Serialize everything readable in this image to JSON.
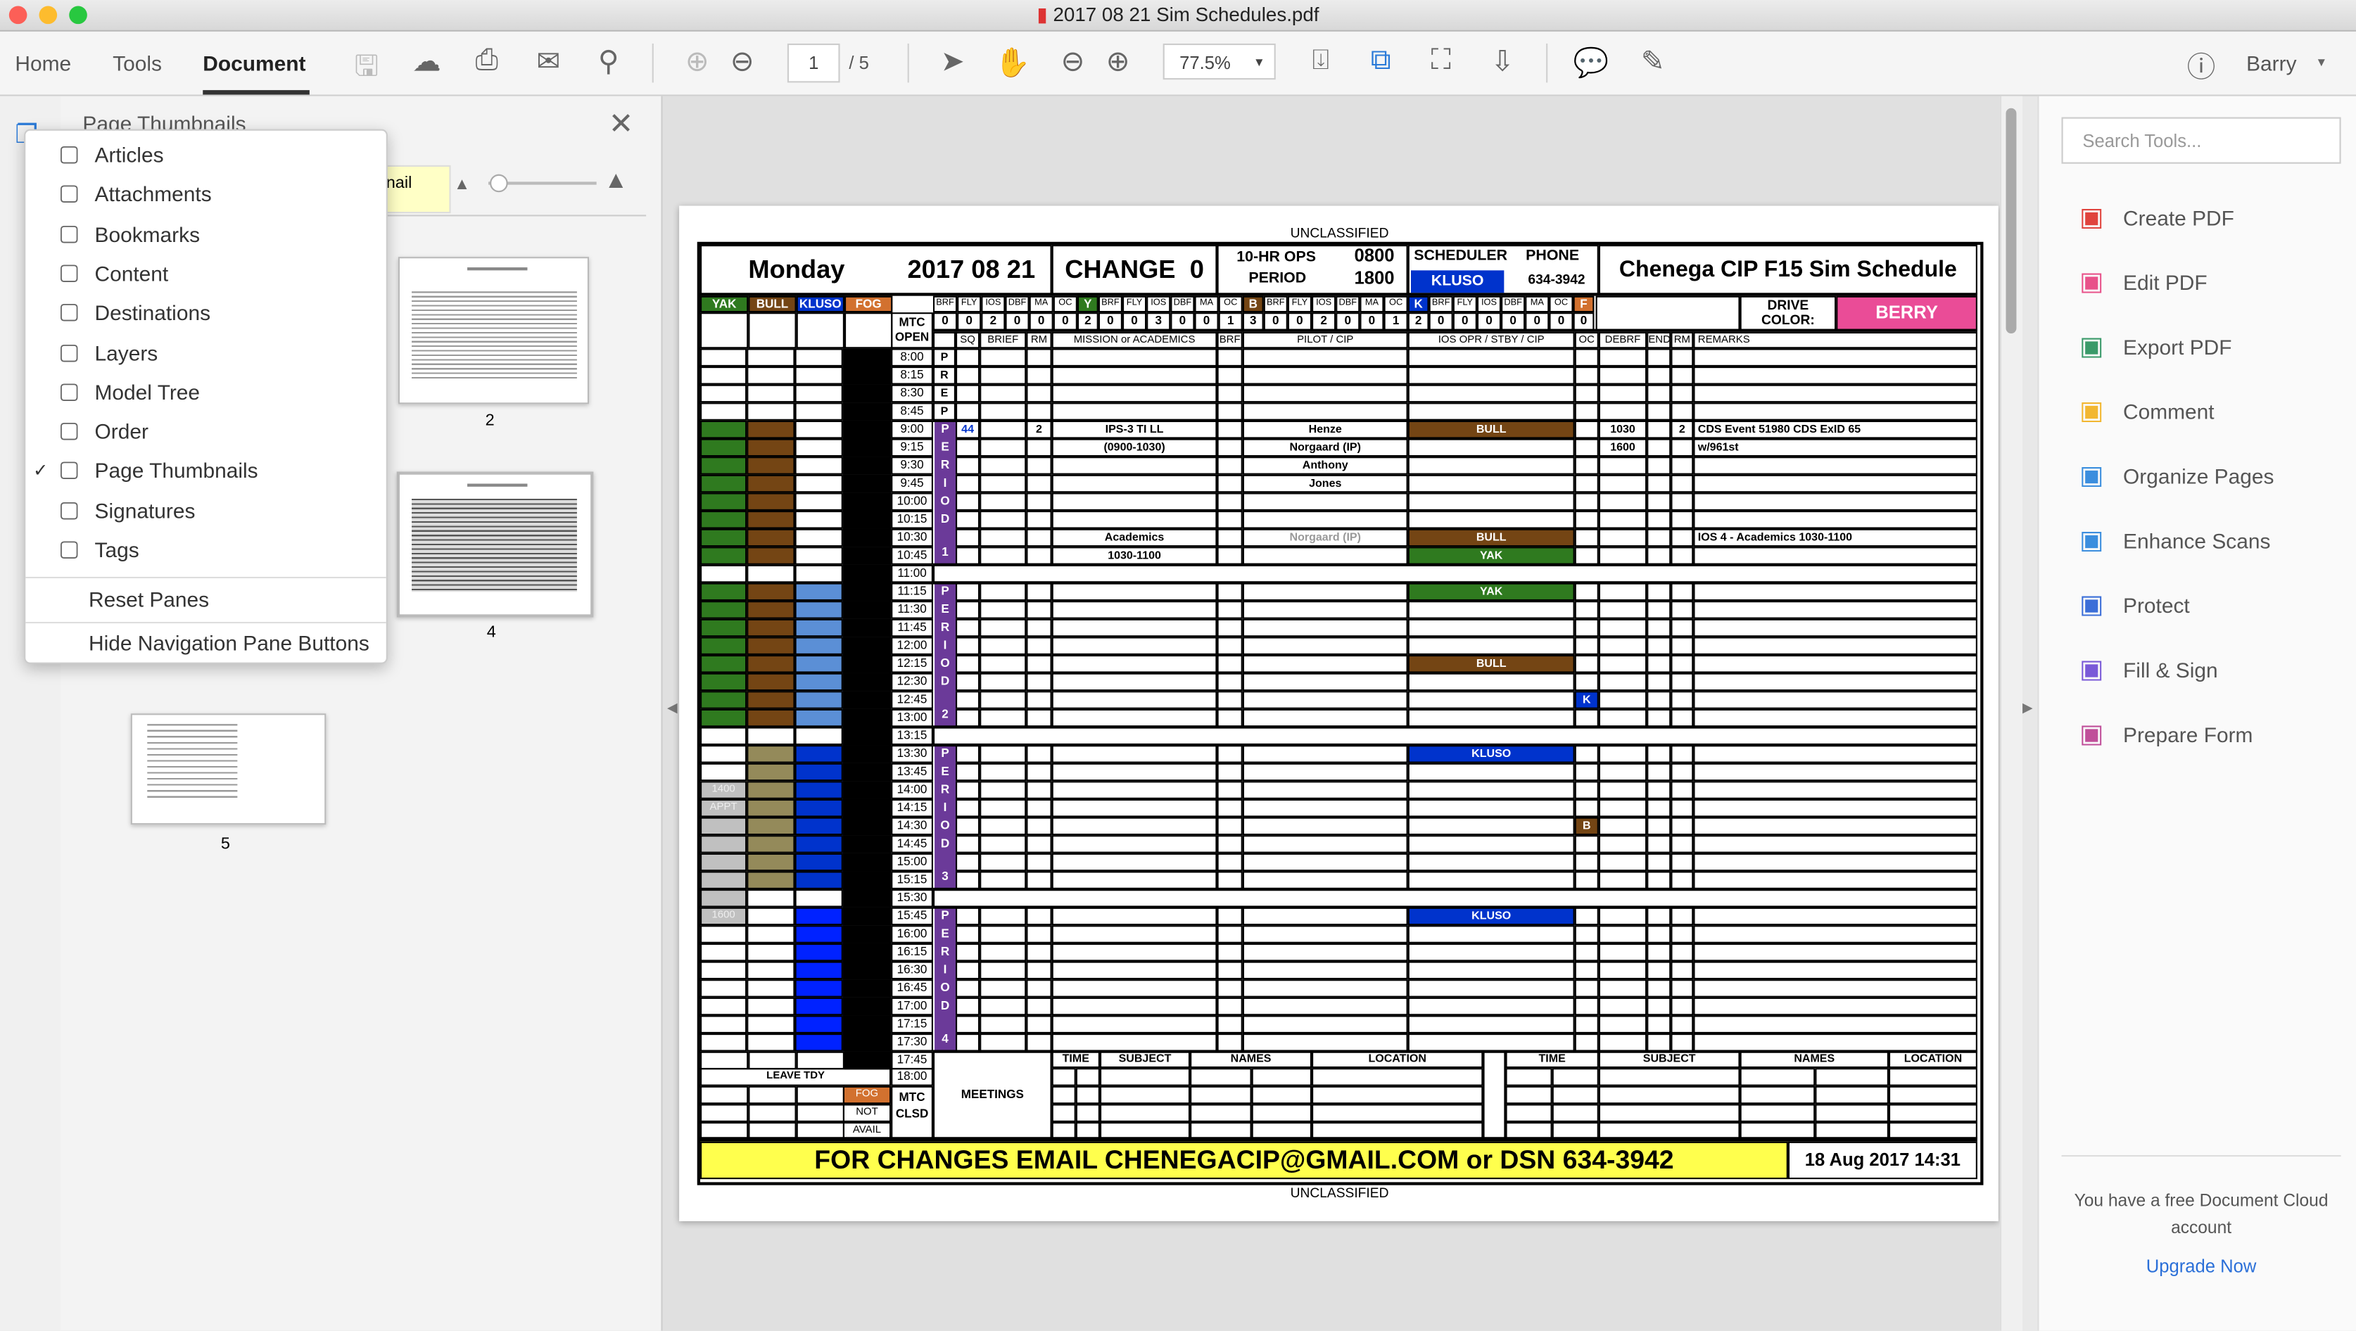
{
  "window": {
    "title": "2017 08 21 Sim Schedules.pdf"
  },
  "toolbar": {
    "tabs": [
      "Home",
      "Tools",
      "Document"
    ],
    "active_tab": "Document",
    "page_current": "1",
    "page_total": "/ 5",
    "zoom": "77.5%",
    "user": "Barry",
    "icons": [
      "save-icon",
      "upload-icon",
      "print-icon",
      "email-icon",
      "search-icon",
      "page-up-icon",
      "page-down-icon",
      "select-arrow-icon",
      "hand-icon",
      "zoom-out-icon",
      "zoom-in-icon",
      "fit-page-icon",
      "fit-width-icon",
      "full-screen-icon",
      "scroll-mode-icon",
      "comment-icon",
      "pen-icon",
      "help-icon"
    ]
  },
  "left_panel": {
    "title": "Page Thumbnails",
    "tooltip_fragment": "nail",
    "thumbnails": [
      "2",
      "4",
      "5"
    ],
    "menu": {
      "items": [
        {
          "label": "Articles",
          "icon": "articles-icon"
        },
        {
          "label": "Attachments",
          "icon": "paperclip-icon"
        },
        {
          "label": "Bookmarks",
          "icon": "bookmark-icon"
        },
        {
          "label": "Content",
          "icon": "content-icon"
        },
        {
          "label": "Destinations",
          "icon": "destinations-icon"
        },
        {
          "label": "Layers",
          "icon": "layers-icon"
        },
        {
          "label": "Model Tree",
          "icon": "model-tree-icon"
        },
        {
          "label": "Order",
          "icon": "order-icon"
        },
        {
          "label": "Page Thumbnails",
          "icon": "page-thumbnails-icon",
          "checked": true
        },
        {
          "label": "Signatures",
          "icon": "signature-icon"
        },
        {
          "label": "Tags",
          "icon": "tag-icon"
        }
      ],
      "actions": [
        "Reset Panes",
        "Hide Navigation Pane Buttons"
      ]
    }
  },
  "right_panel": {
    "search_placeholder": "Search Tools...",
    "tools": [
      {
        "label": "Create PDF",
        "color": "#e0443e",
        "icon": "create-pdf-icon"
      },
      {
        "label": "Edit PDF",
        "color": "#e8528a",
        "icon": "edit-pdf-icon"
      },
      {
        "label": "Export PDF",
        "color": "#3a9a6a",
        "icon": "export-pdf-icon"
      },
      {
        "label": "Comment",
        "color": "#f2b731",
        "icon": "comment-icon"
      },
      {
        "label": "Organize Pages",
        "color": "#3b8ede",
        "icon": "organize-pages-icon"
      },
      {
        "label": "Enhance Scans",
        "color": "#3b8ede",
        "icon": "enhance-scans-icon"
      },
      {
        "label": "Protect",
        "color": "#3b6ed8",
        "icon": "shield-icon"
      },
      {
        "label": "Fill & Sign",
        "color": "#7a5ad8",
        "icon": "fill-sign-icon"
      },
      {
        "label": "Prepare Form",
        "color": "#c04f9a",
        "icon": "prepare-form-icon"
      }
    ],
    "footer_text": "You have a free Document Cloud account",
    "upgrade_link": "Upgrade Now"
  },
  "schedule": {
    "classification": "UNCLASSIFIED",
    "day": "Monday",
    "date": "2017 08 21",
    "change_label": "CHANGE",
    "change": "0",
    "ops_label1": "10-HR OPS",
    "ops_label2": "PERIOD",
    "ops_start": "0800",
    "ops_end": "1800",
    "scheduler_label": "SCHEDULER",
    "phone_label": "PHONE",
    "scheduler": "KLUSO",
    "phone": "634-3942",
    "title": "Chenega CIP F15 Sim Schedule",
    "colors": {
      "yak": "#2f7a1f",
      "bull": "#744514",
      "kluso": "#0033cc",
      "fog": "#d2712f",
      "period": "#6b3a99",
      "berry": "#ea4c97",
      "olive": "#948a5a",
      "gray": "#c0c0c0",
      "lightblue": "#5b8fd6",
      "brightblue": "#0022ff",
      "yellow": "#ffff4d"
    },
    "people": [
      {
        "name": "YAK",
        "key": "yak",
        "letter": "Y"
      },
      {
        "name": "BULL",
        "key": "bull",
        "letter": "B"
      },
      {
        "name": "KLUSO",
        "key": "kluso",
        "letter": "K"
      },
      {
        "name": "FOG",
        "key": "fog",
        "letter": "F"
      }
    ],
    "count_headers": [
      "BRF",
      "FLY",
      "IOS",
      "DBF",
      "MA",
      "OC"
    ],
    "counts": [
      {
        "vals": [
          "0",
          "0",
          "2",
          "0",
          "0",
          "0"
        ],
        "total": "2"
      },
      {
        "vals": [
          "0",
          "0",
          "3",
          "0",
          "0",
          "1"
        ],
        "total": "3"
      },
      {
        "vals": [
          "0",
          "0",
          "2",
          "0",
          "0",
          "1"
        ],
        "total": "2"
      },
      {
        "vals": [
          "0",
          "0",
          "0",
          "0",
          "0",
          "0"
        ],
        "total": "0"
      }
    ],
    "mtc_open": [
      "MTC",
      "OPEN"
    ],
    "drive_label": "DRIVE COLOR:",
    "drive_color": "BERRY",
    "column_headers": {
      "sq": "SQ",
      "brief": "BRIEF",
      "rm": "RM",
      "mission": "MISSION or ACADEMICS",
      "brf": "BRF",
      "pilot": "PILOT / CIP",
      "ios": "IOS OPR / STBY / CIP",
      "oc": "OC",
      "debrf": "DEBRF",
      "end": "END",
      "rm2": "RM",
      "remarks": "REMARKS"
    },
    "times": [
      "8:00",
      "8:15",
      "8:30",
      "8:45",
      "9:00",
      "9:15",
      "9:30",
      "9:45",
      "10:00",
      "10:15",
      "10:30",
      "10:45",
      "11:00",
      "11:15",
      "11:30",
      "11:45",
      "12:00",
      "12:15",
      "12:30",
      "12:45",
      "13:00",
      "13:15",
      "13:30",
      "13:45",
      "14:00",
      "14:15",
      "14:30",
      "14:45",
      "15:00",
      "15:15",
      "15:30",
      "15:45",
      "16:00",
      "16:15",
      "16:30",
      "16:45",
      "17:00",
      "17:15",
      "17:30",
      "17:45",
      "18:00"
    ],
    "prep_letters": [
      "P",
      "R",
      "E",
      "P"
    ],
    "break_times": [
      "11:00",
      "13:15",
      "15:30"
    ],
    "periods": [
      {
        "from": "9:00",
        "to": "10:45",
        "label": "1"
      },
      {
        "from": "11:15",
        "to": "13:00",
        "label": "2"
      },
      {
        "from": "13:30",
        "to": "15:15",
        "label": "3"
      },
      {
        "from": "15:45",
        "to": "17:30",
        "label": "4"
      }
    ],
    "period_word": "PERIOD",
    "availability": [
      {
        "col": "yak",
        "from": "9:00",
        "to": "10:45",
        "color": "#2f7a1f"
      },
      {
        "col": "bull",
        "from": "9:00",
        "to": "10:45",
        "color": "#744514"
      },
      {
        "col": "yak",
        "from": "11:15",
        "to": "13:00",
        "color": "#2f7a1f"
      },
      {
        "col": "bull",
        "from": "11:15",
        "to": "13:00",
        "color": "#744514"
      },
      {
        "col": "kluso",
        "from": "11:15",
        "to": "13:00",
        "color": "#5b8fd6"
      },
      {
        "col": "yak",
        "from": "14:00",
        "to": "15:45",
        "color": "#c0c0c0"
      },
      {
        "col": "bull",
        "from": "13:30",
        "to": "15:15",
        "color": "#948a5a"
      },
      {
        "col": "kluso",
        "from": "13:30",
        "to": "15:15",
        "color": "#0033cc"
      },
      {
        "col": "kluso",
        "from": "15:45",
        "to": "17:30",
        "color": "#0022ff"
      },
      {
        "col": "fog",
        "from": "8:00",
        "to": "17:45",
        "color": "#000000"
      }
    ],
    "availability_notes": [
      {
        "col": "yak",
        "time": "14:00",
        "text": "1400"
      },
      {
        "col": "yak",
        "time": "14:15",
        "text": "APPT"
      },
      {
        "col": "yak",
        "time": "15:45",
        "text": "1600"
      }
    ],
    "entries": [
      {
        "time": "9:00",
        "col": "sq",
        "text": "44",
        "fg": "#0033cc"
      },
      {
        "time": "9:00",
        "col": "rm",
        "text": "2"
      },
      {
        "time": "9:00",
        "col": "mission",
        "text": "IPS-3 TI LL"
      },
      {
        "time": "9:00",
        "col": "pilot",
        "text": "Henze"
      },
      {
        "time": "9:00",
        "col": "ios",
        "text": "BULL",
        "bg": "#744514",
        "fg": "#ffffff"
      },
      {
        "time": "9:00",
        "col": "debrf",
        "text": "1030"
      },
      {
        "time": "9:00",
        "col": "rm2",
        "text": "2"
      },
      {
        "time": "9:00",
        "col": "remarks",
        "text": "CDS Event 51980 CDS ExID 65"
      },
      {
        "time": "9:15",
        "col": "mission",
        "text": "(0900-1030)"
      },
      {
        "time": "9:15",
        "col": "pilot",
        "text": "Norgaard (IP)"
      },
      {
        "time": "9:15",
        "col": "debrf",
        "text": "1600"
      },
      {
        "time": "9:15",
        "col": "remarks",
        "text": "w/961st"
      },
      {
        "time": "9:30",
        "col": "pilot",
        "text": "Anthony"
      },
      {
        "time": "9:45",
        "col": "pilot",
        "text": "Jones"
      },
      {
        "time": "10:30",
        "col": "mission",
        "text": "Academics"
      },
      {
        "time": "10:30",
        "col": "pilot",
        "text": "Norgaard (IP)",
        "fg": "#999999"
      },
      {
        "time": "10:30",
        "col": "ios",
        "text": "BULL",
        "bg": "#744514",
        "fg": "#ffffff"
      },
      {
        "time": "10:30",
        "col": "remarks",
        "text": "IOS 4 - Academics 1030-1100"
      },
      {
        "time": "10:45",
        "col": "mission",
        "text": "1030-1100"
      },
      {
        "time": "10:45",
        "col": "ios",
        "text": "YAK",
        "bg": "#2f7a1f",
        "fg": "#ffffff"
      },
      {
        "time": "11:15",
        "col": "ios",
        "text": "YAK",
        "bg": "#2f7a1f",
        "fg": "#ffffff"
      },
      {
        "time": "12:15",
        "col": "ios",
        "text": "BULL",
        "bg": "#744514",
        "fg": "#ffffff"
      },
      {
        "time": "12:45",
        "col": "oc",
        "text": "K",
        "bg": "#0033cc",
        "fg": "#ffffff"
      },
      {
        "time": "13:30",
        "col": "ios",
        "text": "KLUSO",
        "bg": "#0033cc",
        "fg": "#ffffff"
      },
      {
        "time": "14:30",
        "col": "oc",
        "text": "B",
        "bg": "#744514",
        "fg": "#ffffff"
      },
      {
        "time": "15:45",
        "col": "ios",
        "text": "KLUSO",
        "bg": "#0033cc",
        "fg": "#ffffff"
      }
    ],
    "leave_label": "LEAVE  TDY",
    "fog_not_avail": [
      "FOG",
      "NOT",
      "AVAIL"
    ],
    "mtc_closed": [
      "MTC",
      "CLSD"
    ],
    "meetings_label": "MEETINGS",
    "meeting_headers": [
      "TIME",
      "SUBJECT",
      "NAMES",
      "LOCATION"
    ],
    "footer": "FOR CHANGES EMAIL CHENEGACIP@GMAIL.COM or DSN 634-3942",
    "timestamp": "18 Aug 2017  14:31"
  }
}
